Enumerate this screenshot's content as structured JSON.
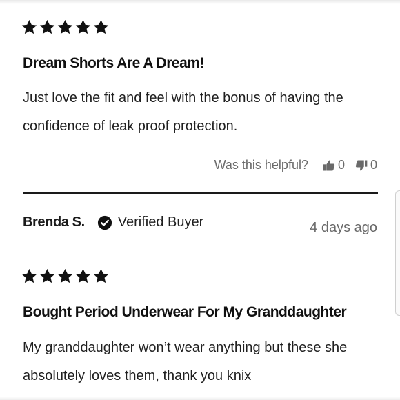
{
  "reviews": [
    {
      "rating": 5,
      "title": "Dream Shorts Are A Dream!",
      "body": "Just love the fit and feel with the bonus of having the confidence of leak proof protection.",
      "helpful": {
        "label": "Was this helpful?",
        "up_count": "0",
        "down_count": "0"
      }
    },
    {
      "reviewer": "Brenda S.",
      "verified_label": "Verified Buyer",
      "date": "4 days ago",
      "rating": 5,
      "title": "Bought Period Underwear For My Granddaughter",
      "body": "My granddaughter won’t wear anything but these she absolutely loves them, thank you knix"
    }
  ],
  "icons": {
    "star": "star-icon",
    "thumbs_up": "thumbs-up-icon",
    "thumbs_down": "thumbs-down-icon",
    "verified": "check-circle-icon"
  },
  "colors": {
    "text": "#1a1a1a",
    "muted": "#6a6a6a",
    "star": "#111111"
  }
}
